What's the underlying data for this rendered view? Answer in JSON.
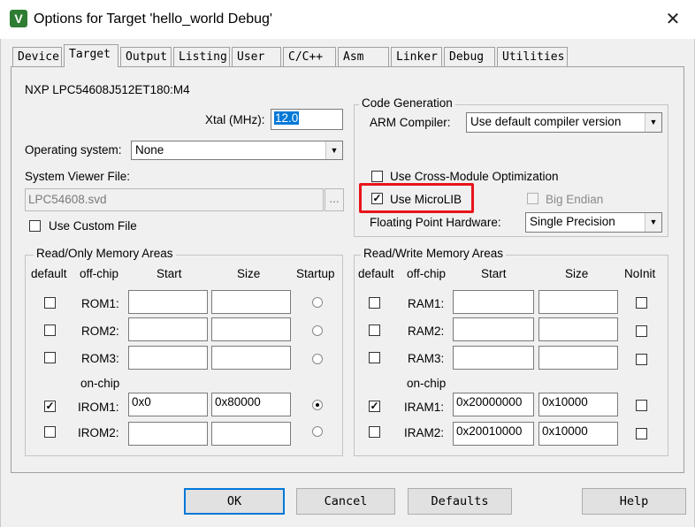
{
  "window": {
    "title": "Options for Target 'hello_world Debug'",
    "app_icon": "V",
    "close_glyph": "✕"
  },
  "tabs": [
    "Device",
    "Target",
    "Output",
    "Listing",
    "User",
    "C/C++",
    "Asm",
    "Linker",
    "Debug",
    "Utilities"
  ],
  "active_tab": "Target",
  "target": {
    "device_name": "NXP LPC54608J512ET180:M4",
    "xtal_label": "Xtal (MHz):",
    "xtal_value": "12.0",
    "os_label": "Operating system:",
    "os_value": "None",
    "sysview_label": "System Viewer File:",
    "sysview_value": "LPC54608.svd",
    "browse_label": "...",
    "custom_file_label": "Use Custom File"
  },
  "code_generation": {
    "title": "Code Generation",
    "compiler_label": "ARM Compiler:",
    "compiler_value": "Use default compiler version",
    "cross_module_label": "Use Cross-Module Optimization",
    "microlib_label": "Use MicroLIB",
    "microlib_checked": "✓",
    "big_endian_label": "Big Endian",
    "fpu_label": "Floating Point Hardware:",
    "fpu_value": "Single Precision"
  },
  "ro_memory": {
    "title": "Read/Only Memory Areas",
    "headers": {
      "default": "default",
      "offchip": "off-chip",
      "start": "Start",
      "size": "Size",
      "startup": "Startup"
    },
    "onchip_label": "on-chip",
    "rows": [
      {
        "label": "ROM1:",
        "start": "",
        "size": "",
        "default": "",
        "startup": false
      },
      {
        "label": "ROM2:",
        "start": "",
        "size": "",
        "default": "",
        "startup": false
      },
      {
        "label": "ROM3:",
        "start": "",
        "size": "",
        "default": "",
        "startup": false
      },
      {
        "label": "IROM1:",
        "start": "0x0",
        "size": "0x80000",
        "default": "✓",
        "startup": true
      },
      {
        "label": "IROM2:",
        "start": "",
        "size": "",
        "default": "",
        "startup": false
      }
    ]
  },
  "rw_memory": {
    "title": "Read/Write Memory Areas",
    "headers": {
      "default": "default",
      "offchip": "off-chip",
      "start": "Start",
      "size": "Size",
      "noinit": "NoInit"
    },
    "onchip_label": "on-chip",
    "rows": [
      {
        "label": "RAM1:",
        "start": "",
        "size": "",
        "default": ""
      },
      {
        "label": "RAM2:",
        "start": "",
        "size": "",
        "default": ""
      },
      {
        "label": "RAM3:",
        "start": "",
        "size": "",
        "default": ""
      },
      {
        "label": "IRAM1:",
        "start": "0x20000000",
        "size": "0x10000",
        "default": "✓"
      },
      {
        "label": "IRAM2:",
        "start": "0x20010000",
        "size": "0x10000",
        "default": ""
      }
    ]
  },
  "buttons": {
    "ok": "OK",
    "cancel": "Cancel",
    "defaults": "Defaults",
    "help": "Help"
  },
  "colors": {
    "highlight": "#e8141a",
    "selection": "#0078d7"
  }
}
